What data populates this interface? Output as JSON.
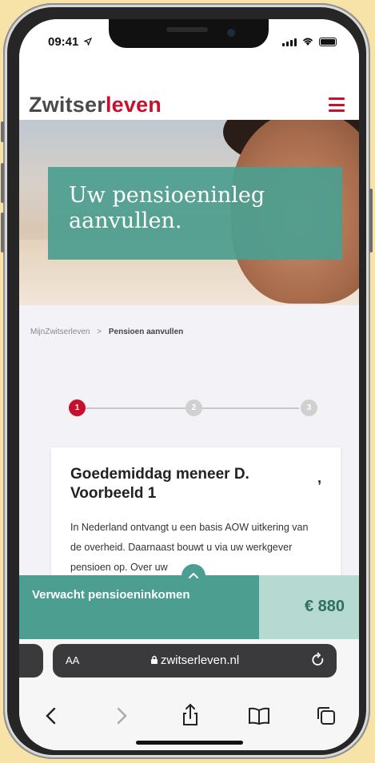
{
  "status_bar": {
    "time": "09:41"
  },
  "header": {
    "logo_part1": "Zwitser",
    "logo_part2": "leven",
    "menu_icon": "hamburger-menu-icon"
  },
  "hero": {
    "title": "Uw pensioeninleg aanvullen."
  },
  "breadcrumb": {
    "items": [
      "MijnZwitserleven",
      "Pensioen aanvullen"
    ],
    "separator": ">"
  },
  "stepper": {
    "steps": [
      "1",
      "2",
      "3"
    ],
    "active_step": 1
  },
  "card": {
    "title": "Goedemiddag meneer D. Voorbeeld 1",
    "trailing": ",",
    "body": "In Nederland ontvangt u een basis AOW uitkering van de overheid. Daarnaast bouwt u via uw werkgever pensioen op. Over uw"
  },
  "sticky_footer": {
    "label": "Verwacht pensioeninkomen",
    "value": "€ 880"
  },
  "safari": {
    "aa_label": "AA",
    "url": "zwitserleven.nl"
  },
  "colors": {
    "brand_red": "#c8102e",
    "teal": "#4c9e90",
    "teal_light": "#b6d9d2"
  }
}
